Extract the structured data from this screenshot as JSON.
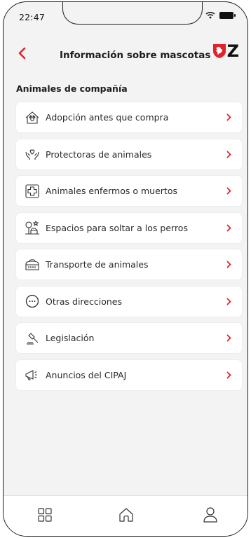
{
  "status_bar": {
    "time": "22:47"
  },
  "header": {
    "title": "Información sobre mascotas",
    "logo_letter": "Z"
  },
  "section": {
    "title": "Animales de compañía"
  },
  "menu": [
    {
      "label": "Adopción antes que compra",
      "icon": "house-pet-icon"
    },
    {
      "label": "Protectoras de animales",
      "icon": "hands-heart-icon"
    },
    {
      "label": "Animales enfermos o muertos",
      "icon": "medical-cross-icon"
    },
    {
      "label": "Espacios para soltar a los perros",
      "icon": "dog-park-icon"
    },
    {
      "label": "Transporte de animales",
      "icon": "pet-carrier-icon"
    },
    {
      "label": "Otras direcciones",
      "icon": "more-dots-icon"
    },
    {
      "label": "Legislación",
      "icon": "gavel-icon"
    },
    {
      "label": "Anuncios del CIPAJ",
      "icon": "megaphone-icon"
    }
  ],
  "colors": {
    "accent": "#e0242b",
    "background": "#f3f3f3",
    "card": "#ffffff"
  },
  "bottom_nav": [
    "grid-menu-icon",
    "home-icon",
    "user-icon"
  ]
}
